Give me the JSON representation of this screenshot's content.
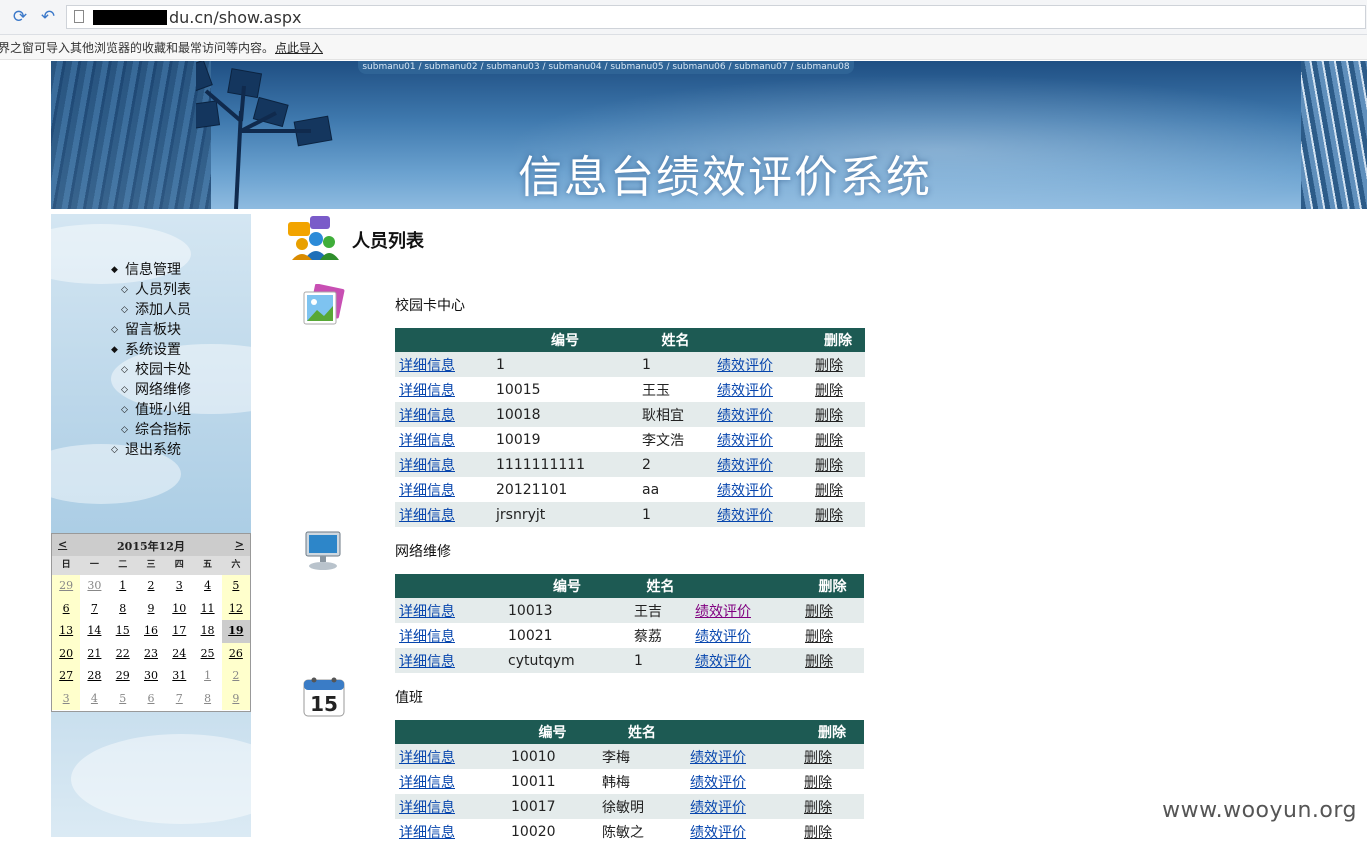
{
  "browser": {
    "url_visible": "du.cn/show.aspx",
    "infobar_text": "界之窗可导入其他浏览器的收藏和最常访问等内容。",
    "infobar_link": "点此导入"
  },
  "header": {
    "submenu": "submanu01 / submanu02 / submanu03 / submanu04 / submanu05 / submanu06 / submanu07 / submanu08",
    "system_title": "信息台绩效评价系统"
  },
  "nav": {
    "items": [
      {
        "label": "信息管理",
        "level": 0,
        "bullet": "◆"
      },
      {
        "label": "人员列表",
        "level": 1,
        "bullet": "◇"
      },
      {
        "label": "添加人员",
        "level": 1,
        "bullet": "◇"
      },
      {
        "label": "留言板块",
        "level": 0,
        "bullet": "◇"
      },
      {
        "label": "系统设置",
        "level": 0,
        "bullet": "◆"
      },
      {
        "label": "校园卡处",
        "level": 1,
        "bullet": "◇"
      },
      {
        "label": "网络维修",
        "level": 1,
        "bullet": "◇"
      },
      {
        "label": "值班小组",
        "level": 1,
        "bullet": "◇"
      },
      {
        "label": "综合指标",
        "level": 1,
        "bullet": "◇"
      },
      {
        "label": "退出系统",
        "level": 0,
        "bullet": "◇"
      }
    ]
  },
  "calendar": {
    "title": "2015年12月",
    "prev": "<",
    "next": ">",
    "dow": [
      "日",
      "一",
      "二",
      "三",
      "四",
      "五",
      "六"
    ],
    "weeks": [
      [
        "29",
        "30",
        "1",
        "2",
        "3",
        "4",
        "5"
      ],
      [
        "6",
        "7",
        "8",
        "9",
        "10",
        "11",
        "12"
      ],
      [
        "13",
        "14",
        "15",
        "16",
        "17",
        "18",
        "19"
      ],
      [
        "20",
        "21",
        "22",
        "23",
        "24",
        "25",
        "26"
      ],
      [
        "27",
        "28",
        "29",
        "30",
        "31",
        "1",
        "2"
      ],
      [
        "3",
        "4",
        "5",
        "6",
        "7",
        "8",
        "9"
      ]
    ]
  },
  "main": {
    "title": "人员列表",
    "sections": [
      {
        "title": "校园卡中心",
        "headers": [
          "",
          "编号",
          "姓名",
          "",
          "删除"
        ],
        "rows": [
          {
            "detail": "详细信息",
            "id": "1",
            "name": "1",
            "eval": "绩效评价",
            "del": "删除"
          },
          {
            "detail": "详细信息",
            "id": "10015",
            "name": "王玉",
            "eval": "绩效评价",
            "del": "删除"
          },
          {
            "detail": "详细信息",
            "id": "10018",
            "name": "耿相宜",
            "eval": "绩效评价",
            "del": "删除"
          },
          {
            "detail": "详细信息",
            "id": "10019",
            "name": "李文浩",
            "eval": "绩效评价",
            "del": "删除"
          },
          {
            "detail": "详细信息",
            "id": "1111111111",
            "name": "2",
            "eval": "绩效评价",
            "del": "删除"
          },
          {
            "detail": "详细信息",
            "id": "20121101",
            "name": "aa",
            "eval": "绩效评价",
            "del": "删除"
          },
          {
            "detail": "详细信息",
            "id": "jrsnryjt",
            "name": "1",
            "eval": "绩效评价",
            "del": "删除"
          }
        ]
      },
      {
        "title": "网络维修",
        "headers": [
          "",
          "编号",
          "姓名",
          "",
          "删除"
        ],
        "rows": [
          {
            "detail": "详细信息",
            "id": "10013",
            "name": "王吉",
            "eval": "绩效评价",
            "del": "删除"
          },
          {
            "detail": "详细信息",
            "id": "10021",
            "name": "蔡荔",
            "eval": "绩效评价",
            "del": "删除"
          },
          {
            "detail": "详细信息",
            "id": "cytutqym",
            "name": "1",
            "eval": "绩效评价",
            "del": "删除"
          }
        ]
      },
      {
        "title": "值班",
        "headers": [
          "",
          "编号",
          "姓名",
          "",
          "删除"
        ],
        "rows": [
          {
            "detail": "详细信息",
            "id": "10010",
            "name": "李梅",
            "eval": "绩效评价",
            "del": "删除"
          },
          {
            "detail": "详细信息",
            "id": "10011",
            "name": "韩梅",
            "eval": "绩效评价",
            "del": "删除"
          },
          {
            "detail": "详细信息",
            "id": "10017",
            "name": "徐敏明",
            "eval": "绩效评价",
            "del": "删除"
          },
          {
            "detail": "详细信息",
            "id": "10020",
            "name": "陈敏之",
            "eval": "绩效评价",
            "del": "删除"
          }
        ]
      }
    ]
  },
  "watermark": "www.wooyun.org",
  "colors": {
    "table_header": "#1d5a53",
    "row_alt": "#e4ebeb",
    "link": "#0645ad",
    "visited": "#800080"
  }
}
